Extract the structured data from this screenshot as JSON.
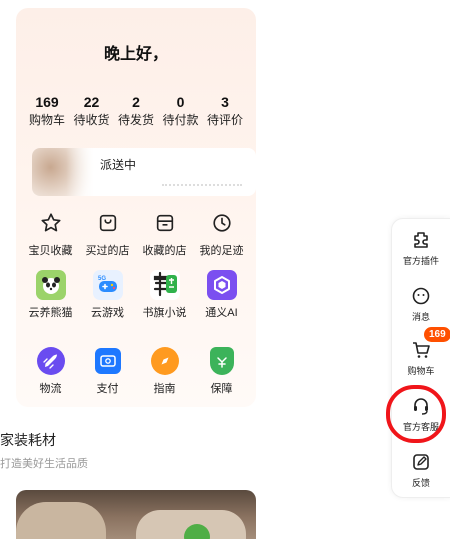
{
  "greeting": "晚上好，",
  "counts": [
    {
      "num": "169",
      "label": "购物车"
    },
    {
      "num": "22",
      "label": "待收货"
    },
    {
      "num": "2",
      "label": "待发货"
    },
    {
      "num": "0",
      "label": "待付款"
    },
    {
      "num": "3",
      "label": "待评价"
    }
  ],
  "delivery": {
    "status": "派送中"
  },
  "shortcuts": [
    {
      "label": "宝贝收藏",
      "icon": "star-icon"
    },
    {
      "label": "买过的店",
      "icon": "shopping-bag-icon"
    },
    {
      "label": "收藏的店",
      "icon": "store-icon"
    },
    {
      "label": "我的足迹",
      "icon": "clock-icon"
    }
  ],
  "apps": [
    {
      "label": "云养熊猫",
      "icon": "panda-icon",
      "color": "#9bd36a"
    },
    {
      "label": "云游戏",
      "icon": "gamepad-icon",
      "color": "#e8f1ff"
    },
    {
      "label": "书旗小说",
      "icon": "book-icon",
      "color": "#ffffff"
    },
    {
      "label": "通义AI",
      "icon": "ai-icon",
      "color": "#7b4ff0"
    }
  ],
  "services": [
    {
      "label": "物流",
      "icon": "rocket-icon",
      "color": "#6a4cf0"
    },
    {
      "label": "支付",
      "icon": "wallet-icon",
      "color": "#1e78ff"
    },
    {
      "label": "指南",
      "icon": "compass-icon",
      "color": "#ff9a1f"
    },
    {
      "label": "保障",
      "icon": "shield-icon",
      "color": "#3cb35a"
    }
  ],
  "section": {
    "title": "家装耗材",
    "subtitle": "打造美好生活品质"
  },
  "sidebar": [
    {
      "label": "官方插件",
      "icon": "plugin-icon"
    },
    {
      "label": "消息",
      "icon": "message-icon"
    },
    {
      "label": "购物车",
      "icon": "cart-icon",
      "badge": "169"
    },
    {
      "label": "官方客服",
      "icon": "headset-icon"
    },
    {
      "label": "反馈",
      "icon": "edit-icon"
    }
  ]
}
